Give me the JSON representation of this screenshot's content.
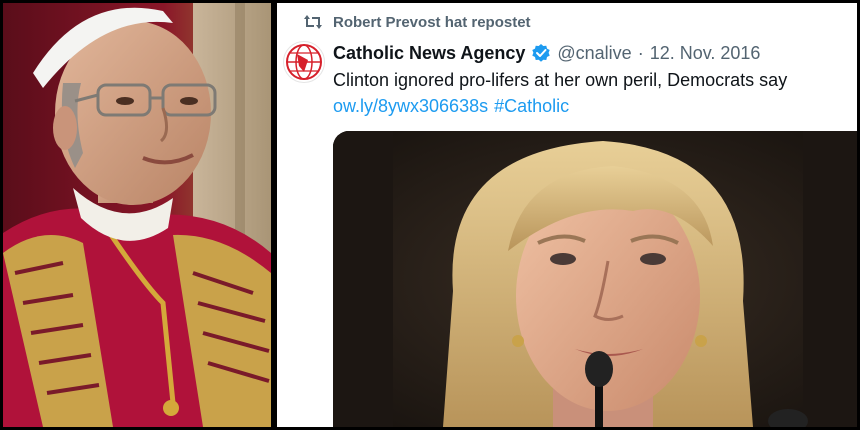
{
  "repost": {
    "label": "Robert Prevost hat repostet",
    "icon": "repost-icon"
  },
  "tweet": {
    "author_name": "Catholic News Agency",
    "verified_icon": "verified-badge-icon",
    "handle": "@cnalive",
    "separator": "·",
    "date": "12. Nov. 2016",
    "text": "Clinton ignored pro-lifers at her own peril, Democrats say",
    "link": "ow.ly/8ywx306638s",
    "hashtag": "#Catholic",
    "avatar_icon": "globe-logo-icon"
  },
  "colors": {
    "link": "#1d9bf0",
    "secondary_text": "#536471",
    "verified": "#1d9bf0",
    "logo_red": "#d6202b"
  }
}
